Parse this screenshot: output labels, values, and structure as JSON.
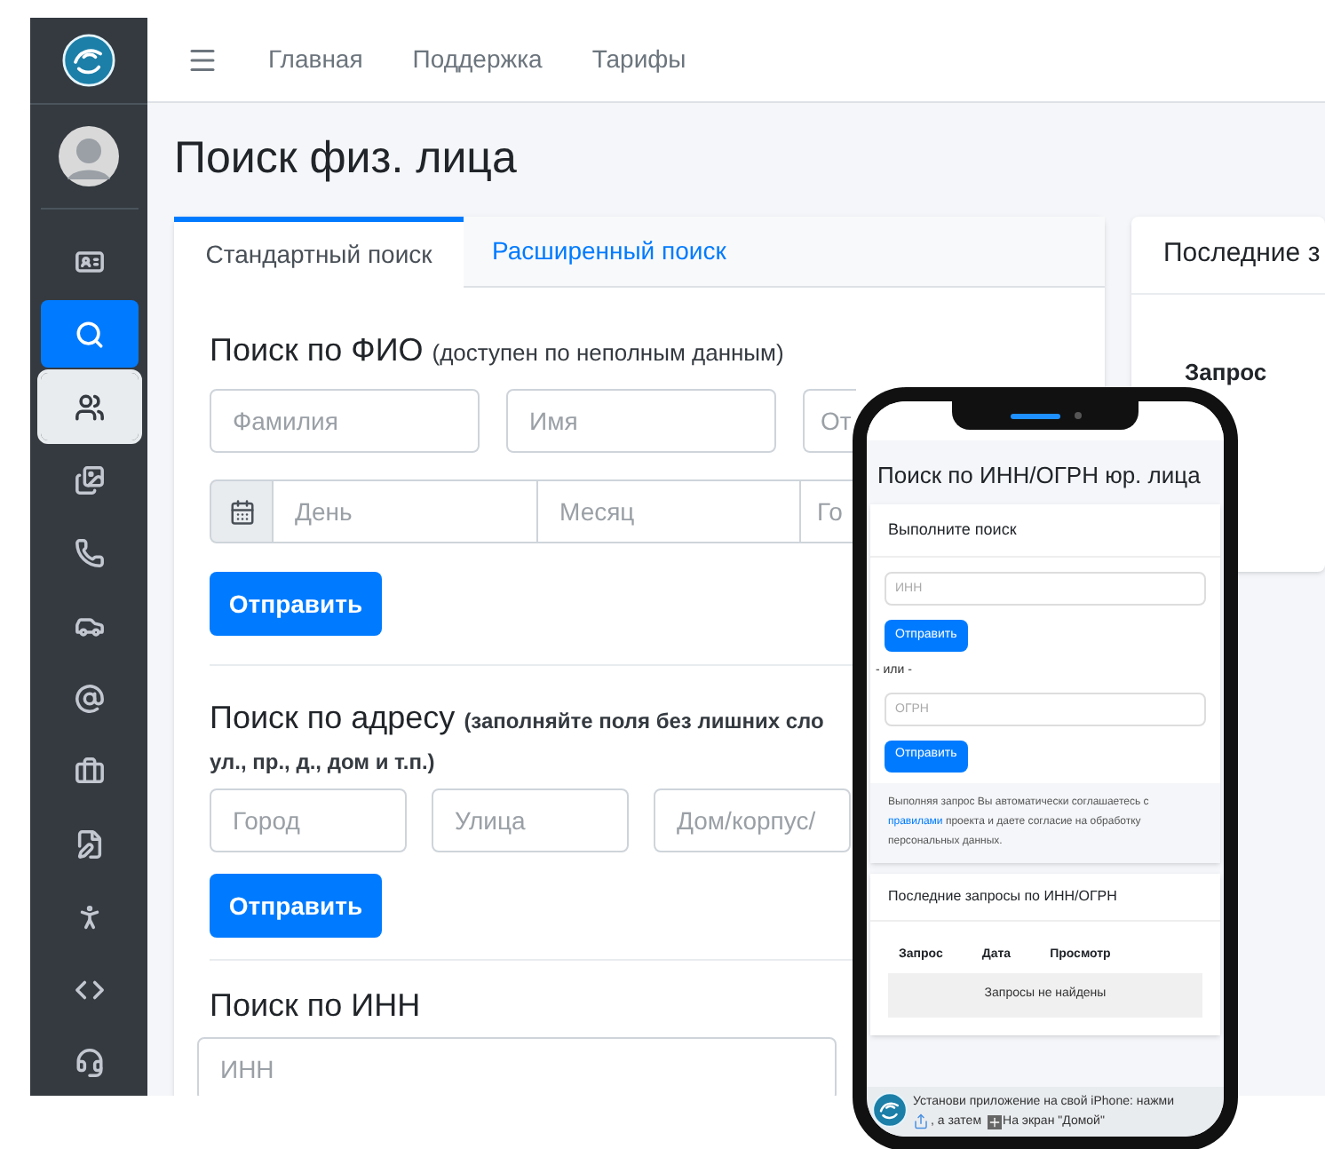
{
  "sidebar": {
    "items": [
      {
        "selected": false,
        "highlighted": false
      },
      {
        "selected": true,
        "highlighted": false
      },
      {
        "selected": false,
        "highlighted": true
      },
      {
        "selected": false,
        "highlighted": false
      },
      {
        "selected": false,
        "highlighted": false
      },
      {
        "selected": false,
        "highlighted": false
      },
      {
        "selected": false,
        "highlighted": false
      },
      {
        "selected": false,
        "highlighted": false
      },
      {
        "selected": false,
        "highlighted": false
      },
      {
        "selected": false,
        "highlighted": false
      },
      {
        "selected": false,
        "highlighted": false
      },
      {
        "selected": false,
        "highlighted": false
      }
    ]
  },
  "top_nav": {
    "links": [
      "Главная",
      "Поддержка",
      "Тарифы"
    ]
  },
  "page_title": "Поиск физ. лица",
  "search_card": {
    "tabs": [
      {
        "label": "Стандартный поиск",
        "selected": true
      },
      {
        "label": "Расширенный поиск",
        "selected": false
      }
    ],
    "fio_section": {
      "heading": "Поиск по ФИО",
      "note": "(доступен по неполным данным)",
      "fields": [
        {
          "placeholder": "Фамилия"
        },
        {
          "placeholder": "Имя"
        },
        {
          "placeholder": "От"
        }
      ],
      "date_fields": [
        {
          "placeholder": "День"
        },
        {
          "placeholder": "Месяц"
        },
        {
          "placeholder": "Го"
        }
      ],
      "button": "Отправить"
    },
    "address_section": {
      "heading": "Поиск по адресу",
      "note": "(заполняйте поля без лишних сло",
      "note_continued": "ул., пр., д., дом и т.п.)",
      "fields": [
        {
          "placeholder": "Город"
        },
        {
          "placeholder": "Улица"
        },
        {
          "placeholder": "Дом/корпус/"
        }
      ],
      "button": "Отправить"
    },
    "inn_section": {
      "heading": "Поиск по ИНН",
      "placeholder": "ИНН"
    }
  },
  "recent_card": {
    "title": "Последние з",
    "columns": [
      "Запрос"
    ]
  },
  "phone": {
    "title": "Поиск по ИНН/ОГРН юр. лица",
    "search_card": {
      "header": "Выполните поиск",
      "inn_placeholder": "ИНН",
      "button": "Отправить",
      "separator": "- или -",
      "ogrn_placeholder": "ОГРН",
      "button_2": "Отправить",
      "consent_before": "Выполняя запрос Вы автоматически соглашаетесь с",
      "consent_link": "правилами",
      "consent_after": "проекта и даете согласие на обработку персональных данных."
    },
    "recent": {
      "title": "Последние запросы по ИНН/ОГРН",
      "columns": [
        "Запрос",
        "Дата",
        "Просмотр"
      ],
      "empty": "Запросы не найдены"
    },
    "install_banner": {
      "text_1": "Установи приложение на свой iPhone: нажми",
      "text_2": ", а затем",
      "text_3": "На экран \"Домой\""
    }
  }
}
